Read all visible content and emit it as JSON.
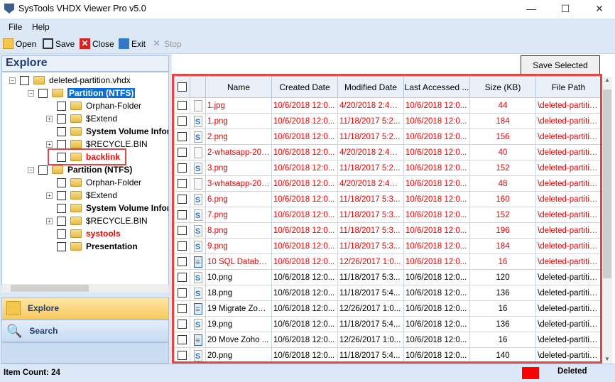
{
  "app": {
    "title": "SysTools VHDX Viewer Pro v5.0"
  },
  "menu": [
    "File",
    "Help"
  ],
  "toolbar": {
    "open": "Open",
    "save": "Save",
    "close": "Close",
    "exit": "Exit",
    "stop": "Stop"
  },
  "left": {
    "header": "Explore",
    "tree": [
      {
        "label": "deleted-partition.vhdx",
        "level": 0,
        "exp": "-",
        "style": ""
      },
      {
        "label": "Partition (NTFS)",
        "level": 1,
        "exp": "-",
        "style": "sel b"
      },
      {
        "label": "Orphan-Folder",
        "level": 2,
        "exp": "",
        "style": ""
      },
      {
        "label": "$Extend",
        "level": 2,
        "exp": "+",
        "style": ""
      },
      {
        "label": "System Volume Information",
        "level": 2,
        "exp": "",
        "style": "b"
      },
      {
        "label": "$RECYCLE.BIN",
        "level": 2,
        "exp": "+",
        "style": ""
      },
      {
        "label": "backlink",
        "level": 2,
        "exp": "",
        "style": "b red hl"
      },
      {
        "label": "Partition (NTFS)",
        "level": 1,
        "exp": "-",
        "style": "b"
      },
      {
        "label": "Orphan-Folder",
        "level": 2,
        "exp": "",
        "style": ""
      },
      {
        "label": "$Extend",
        "level": 2,
        "exp": "+",
        "style": ""
      },
      {
        "label": "System Volume Information",
        "level": 2,
        "exp": "",
        "style": "b"
      },
      {
        "label": "$RECYCLE.BIN",
        "level": 2,
        "exp": "+",
        "style": ""
      },
      {
        "label": "systools",
        "level": 2,
        "exp": "",
        "style": "b red"
      },
      {
        "label": "Presentation",
        "level": 2,
        "exp": "",
        "style": "b"
      }
    ],
    "nav": {
      "explore": "Explore",
      "search": "Search"
    }
  },
  "save_selected": "Save Selected",
  "table": {
    "columns": [
      "Name",
      "Created Date",
      "Modified Date",
      "Last Accessed ...",
      "Size (KB)",
      "File Path"
    ],
    "rows": [
      {
        "icon": "blank",
        "name": "1.jpg",
        "created": "10/6/2018 12:0...",
        "modified": "4/20/2018 2:47:...",
        "accessed": "10/6/2018 12:0...",
        "size": "44",
        "path": "\\deleted-partition...",
        "deleted": true
      },
      {
        "icon": "image",
        "name": "1.png",
        "created": "10/6/2018 12:0...",
        "modified": "11/18/2017 5:2...",
        "accessed": "10/6/2018 12:0...",
        "size": "184",
        "path": "\\deleted-partition...",
        "deleted": true
      },
      {
        "icon": "image",
        "name": "2.png",
        "created": "10/6/2018 12:0...",
        "modified": "11/18/2017 5:2...",
        "accessed": "10/6/2018 12:0...",
        "size": "156",
        "path": "\\deleted-partition...",
        "deleted": true
      },
      {
        "icon": "blank",
        "name": "2-whatsapp-201...",
        "created": "10/6/2018 12:0...",
        "modified": "4/20/2018 2:47:...",
        "accessed": "10/6/2018 12:0...",
        "size": "40",
        "path": "\\deleted-partition...",
        "deleted": true
      },
      {
        "icon": "image",
        "name": "3.png",
        "created": "10/6/2018 12:0...",
        "modified": "11/18/2017 5:2...",
        "accessed": "10/6/2018 12:0...",
        "size": "152",
        "path": "\\deleted-partition...",
        "deleted": true
      },
      {
        "icon": "blank",
        "name": "3-whatsapp-201...",
        "created": "10/6/2018 12:0...",
        "modified": "4/20/2018 2:47:...",
        "accessed": "10/6/2018 12:0...",
        "size": "48",
        "path": "\\deleted-partition...",
        "deleted": true
      },
      {
        "icon": "image",
        "name": "6.png",
        "created": "10/6/2018 12:0...",
        "modified": "11/18/2017 5:3...",
        "accessed": "10/6/2018 12:0...",
        "size": "160",
        "path": "\\deleted-partition...",
        "deleted": true
      },
      {
        "icon": "image",
        "name": "7.png",
        "created": "10/6/2018 12:0...",
        "modified": "11/18/2017 5:3...",
        "accessed": "10/6/2018 12:0...",
        "size": "152",
        "path": "\\deleted-partition...",
        "deleted": true
      },
      {
        "icon": "image",
        "name": "8.png",
        "created": "10/6/2018 12:0...",
        "modified": "11/18/2017 5:3...",
        "accessed": "10/6/2018 12:0...",
        "size": "196",
        "path": "\\deleted-partition...",
        "deleted": true
      },
      {
        "icon": "image",
        "name": "9.png",
        "created": "10/6/2018 12:0...",
        "modified": "11/18/2017 5:3...",
        "accessed": "10/6/2018 12:0...",
        "size": "184",
        "path": "\\deleted-partition...",
        "deleted": true
      },
      {
        "icon": "doc",
        "name": "10 SQL Databas...",
        "created": "10/6/2018 12:0...",
        "modified": "12/26/2017 1:0...",
        "accessed": "10/6/2018 12:0...",
        "size": "16",
        "path": "\\deleted-partition...",
        "deleted": true
      },
      {
        "icon": "image",
        "name": "10.png",
        "created": "10/6/2018 12:0...",
        "modified": "11/18/2017 5:3...",
        "accessed": "10/6/2018 12:0...",
        "size": "120",
        "path": "\\deleted-partition...",
        "deleted": false
      },
      {
        "icon": "image",
        "name": "18.png",
        "created": "10/6/2018 12:0...",
        "modified": "11/18/2017 5:4...",
        "accessed": "10/6/2018 12:0...",
        "size": "136",
        "path": "\\deleted-partition...",
        "deleted": false
      },
      {
        "icon": "doc",
        "name": "19 Migrate Zoho ...",
        "created": "10/6/2018 12:0...",
        "modified": "12/26/2017 1:0...",
        "accessed": "10/6/2018 12:0...",
        "size": "16",
        "path": "\\deleted-partition...",
        "deleted": false
      },
      {
        "icon": "image",
        "name": "19.png",
        "created": "10/6/2018 12:0...",
        "modified": "11/18/2017 5:4...",
        "accessed": "10/6/2018 12:0...",
        "size": "136",
        "path": "\\deleted-partition...",
        "deleted": false
      },
      {
        "icon": "doc",
        "name": "20 Move Zoho ...",
        "created": "10/6/2018 12:0...",
        "modified": "12/26/2017 1:0...",
        "accessed": "10/6/2018 12:0...",
        "size": "16",
        "path": "\\deleted-partition...",
        "deleted": false
      },
      {
        "icon": "image",
        "name": "20.png",
        "created": "10/6/2018 12:0...",
        "modified": "11/18/2017 5:4...",
        "accessed": "10/6/2018 12:0...",
        "size": "140",
        "path": "\\deleted-partition...",
        "deleted": false
      }
    ]
  },
  "status": {
    "item_count": "Item Count: 24",
    "legend": "Deleted",
    "legend_color": "#ff0000",
    "highlight_color": "#e04848"
  }
}
